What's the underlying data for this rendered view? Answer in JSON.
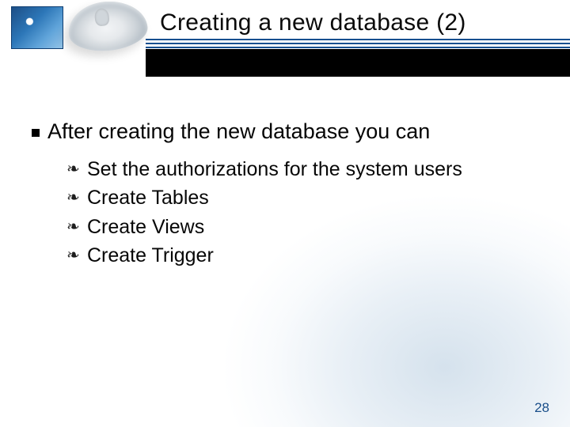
{
  "header": {
    "title": "Creating a new database (2)"
  },
  "body": {
    "bullet": "After creating the new database you can",
    "items": [
      "Set the authorizations for the system users",
      "Create Tables",
      "Create Views",
      "Create Trigger"
    ]
  },
  "page_number": "28"
}
